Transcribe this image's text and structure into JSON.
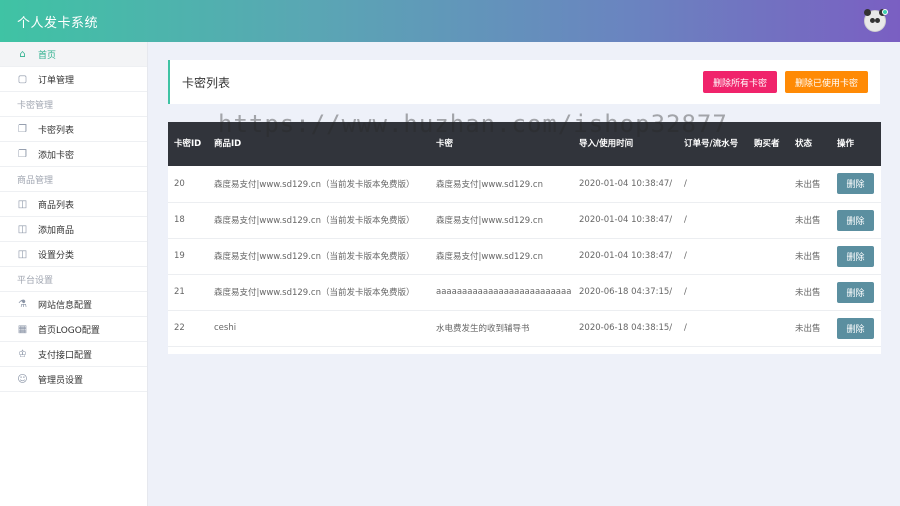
{
  "app": {
    "title": "个人发卡系统"
  },
  "sidebar": {
    "items": [
      {
        "label": "首页",
        "icon": "home-icon",
        "active": true
      },
      {
        "label": "订单管理",
        "icon": "clipboard-icon"
      }
    ],
    "groups": [
      {
        "title": "卡密管理",
        "items": [
          {
            "label": "卡密列表",
            "icon": "cards-icon"
          },
          {
            "label": "添加卡密",
            "icon": "cards-add-icon"
          }
        ]
      },
      {
        "title": "商品管理",
        "items": [
          {
            "label": "商品列表",
            "icon": "book-icon"
          },
          {
            "label": "添加商品",
            "icon": "book-add-icon"
          },
          {
            "label": "设置分类",
            "icon": "book-open-icon"
          }
        ]
      },
      {
        "title": "平台设置",
        "items": [
          {
            "label": "网站信息配置",
            "icon": "flask-icon"
          },
          {
            "label": "首页LOGO配置",
            "icon": "layout-icon"
          },
          {
            "label": "支付接口配置",
            "icon": "crown-icon"
          },
          {
            "label": "管理员设置",
            "icon": "smile-icon"
          }
        ]
      }
    ]
  },
  "main": {
    "title": "卡密列表",
    "buttons": {
      "delete_all": "删除所有卡密",
      "delete_used": "删除已使用卡密"
    },
    "table": {
      "headers": [
        "卡密ID",
        "商品ID",
        "卡密",
        "导入/使用时间",
        "订单号/流水号",
        "购买者",
        "状态",
        "操作"
      ],
      "rows": [
        {
          "id": "20",
          "product": "森度易支付|www.sd129.cn（当前发卡版本免费版）",
          "card": "森度易支付|www.sd129.cn",
          "time": "2020-01-04 10:38:47/",
          "order": "/",
          "buyer": "",
          "status": "未出售",
          "action": "删除"
        },
        {
          "id": "18",
          "product": "森度易支付|www.sd129.cn（当前发卡版本免费版）",
          "card": "森度易支付|www.sd129.cn",
          "time": "2020-01-04 10:38:47/",
          "order": "/",
          "buyer": "",
          "status": "未出售",
          "action": "删除"
        },
        {
          "id": "19",
          "product": "森度易支付|www.sd129.cn（当前发卡版本免费版）",
          "card": "森度易支付|www.sd129.cn",
          "time": "2020-01-04 10:38:47/",
          "order": "/",
          "buyer": "",
          "status": "未出售",
          "action": "删除"
        },
        {
          "id": "21",
          "product": "森度易支付|www.sd129.cn（当前发卡版本免费版）",
          "card": "aaaaaaaaaaaaaaaaaaaaaaaaaa",
          "time": "2020-06-18 04:37:15/",
          "order": "/",
          "buyer": "",
          "status": "未出售",
          "action": "删除"
        },
        {
          "id": "22",
          "product": "ceshi",
          "card": "水电费发生的收到辅导书",
          "time": "2020-06-18 04:38:15/",
          "order": "/",
          "buyer": "",
          "status": "未出售",
          "action": "删除"
        }
      ]
    }
  },
  "watermark": "https://www.huzhan.com/ishop32877",
  "colors": {
    "accent": "#3fc3a4",
    "danger": "#f0236b",
    "warning": "#ff8a05",
    "table_header": "#31343b",
    "delete_button": "#5b8fa0"
  }
}
